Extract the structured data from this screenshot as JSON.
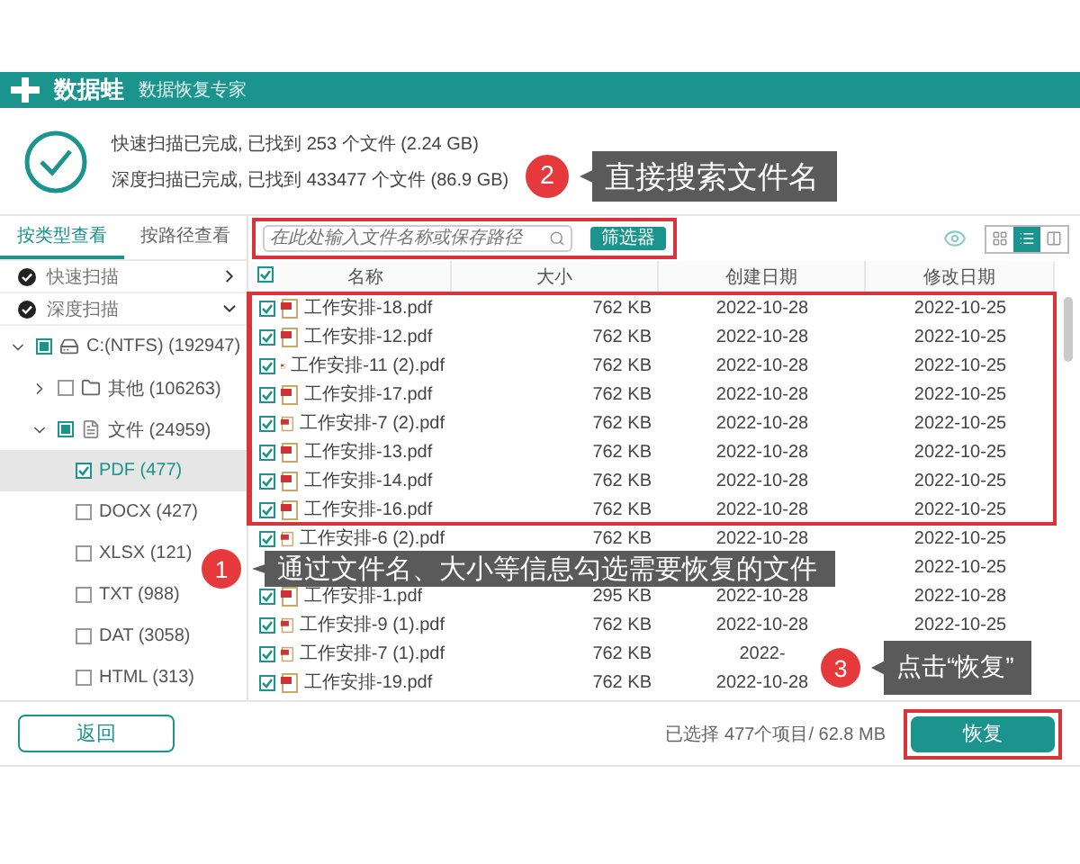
{
  "app": {
    "name": "数据蛙",
    "subtitle": "数据恢复专家"
  },
  "summary": [
    "快速扫描已完成, 已找到 253 个文件 (2.24 GB)",
    "深度扫描已完成, 已找到 433477 个文件 (86.9 GB)"
  ],
  "view_tabs": [
    {
      "label": "按类型查看",
      "selected": true
    },
    {
      "label": "按路径查看",
      "selected": false
    }
  ],
  "scans": [
    {
      "label": "快速扫描",
      "expanded": false
    },
    {
      "label": "深度扫描",
      "expanded": true
    }
  ],
  "tree": [
    {
      "label": "C:(NTFS) (192947)",
      "kind": "drive",
      "checked": false,
      "partial": true,
      "expanded": true,
      "selected": false,
      "children": [
        {
          "label": "其他 (106263)",
          "kind": "folder",
          "checked": false,
          "partial": false,
          "expanded": false,
          "selected": false
        },
        {
          "label": "文件 (24959)",
          "kind": "files",
          "checked": false,
          "partial": true,
          "expanded": true,
          "selected": false,
          "children": [
            {
              "label": "PDF (477)",
              "checked": true,
              "partial": false,
              "selected": true
            },
            {
              "label": "DOCX (427)",
              "checked": false,
              "partial": false,
              "selected": false
            },
            {
              "label": "XLSX (121)",
              "checked": false,
              "partial": false,
              "selected": false
            },
            {
              "label": "TXT (988)",
              "checked": false,
              "partial": false,
              "selected": false
            },
            {
              "label": "DAT (3058)",
              "checked": false,
              "partial": false,
              "selected": false
            },
            {
              "label": "HTML (313)",
              "checked": false,
              "partial": false,
              "selected": false
            }
          ]
        }
      ]
    }
  ],
  "search": {
    "placeholder": "在此处输入文件名称或保存路径",
    "highlighted": true
  },
  "filter_button": "筛选器",
  "view_modes": [
    {
      "kind": "grid",
      "selected": false
    },
    {
      "kind": "list",
      "selected": true
    },
    {
      "kind": "detail",
      "selected": false
    }
  ],
  "table": {
    "all_checked": true,
    "columns": [
      "名称",
      "大小",
      "创建日期",
      "修改日期"
    ],
    "rows": [
      {
        "name": "工作安排-18.pdf",
        "size": "762 KB",
        "created": "2022-10-28",
        "modified": "2022-10-25",
        "checked": true,
        "highlighted": true
      },
      {
        "name": "工作安排-12.pdf",
        "size": "762 KB",
        "created": "2022-10-28",
        "modified": "2022-10-25",
        "checked": true,
        "highlighted": true
      },
      {
        "name": "工作安排-11 (2).pdf",
        "size": "762 KB",
        "created": "2022-10-28",
        "modified": "2022-10-25",
        "checked": true,
        "highlighted": true
      },
      {
        "name": "工作安排-17.pdf",
        "size": "762 KB",
        "created": "2022-10-28",
        "modified": "2022-10-25",
        "checked": true,
        "highlighted": true
      },
      {
        "name": "工作安排-7 (2).pdf",
        "size": "762 KB",
        "created": "2022-10-28",
        "modified": "2022-10-25",
        "checked": true,
        "highlighted": true
      },
      {
        "name": "工作安排-13.pdf",
        "size": "762 KB",
        "created": "2022-10-28",
        "modified": "2022-10-25",
        "checked": true,
        "highlighted": true
      },
      {
        "name": "工作安排-14.pdf",
        "size": "762 KB",
        "created": "2022-10-28",
        "modified": "2022-10-25",
        "checked": true,
        "highlighted": true
      },
      {
        "name": "工作安排-16.pdf",
        "size": "762 KB",
        "created": "2022-10-28",
        "modified": "2022-10-25",
        "checked": true,
        "highlighted": true
      },
      {
        "name": "工作安排-6 (2).pdf",
        "size": "762 KB",
        "created": "2022-10-28",
        "modified": "2022-10-25",
        "checked": true,
        "highlighted": false
      },
      {
        "modified": "2022-10-25",
        "highlighted": false
      },
      {
        "name": "工作安排-1.pdf",
        "size": "295 KB",
        "created": "2022-10-28",
        "modified": "2022-10-28",
        "checked": true,
        "highlighted": false
      },
      {
        "name": "工作安排-9 (1).pdf",
        "size": "762 KB",
        "created": "2022-10-28",
        "modified": "2022-10-25",
        "checked": true,
        "highlighted": false
      },
      {
        "name": "工作安排-7 (1).pdf",
        "size": "762 KB",
        "created": "2022-",
        "checked": true,
        "highlighted": false
      },
      {
        "name": "工作安排-19.pdf",
        "size": "762 KB",
        "created": "2022-10-28",
        "checked": true,
        "highlighted": false
      }
    ]
  },
  "footer": {
    "back_button": "返回",
    "selection": "已选择 477个项目/ 62.8 MB",
    "recover_button": {
      "label": "恢复",
      "highlighted": true
    }
  },
  "callouts": [
    {
      "number": "2",
      "text": "直接搜索文件名"
    },
    {
      "number": "1",
      "text": "通过文件名、大小等信息勾选需要恢复的文件"
    },
    {
      "number": "3",
      "text": "点击“恢复”"
    }
  ]
}
